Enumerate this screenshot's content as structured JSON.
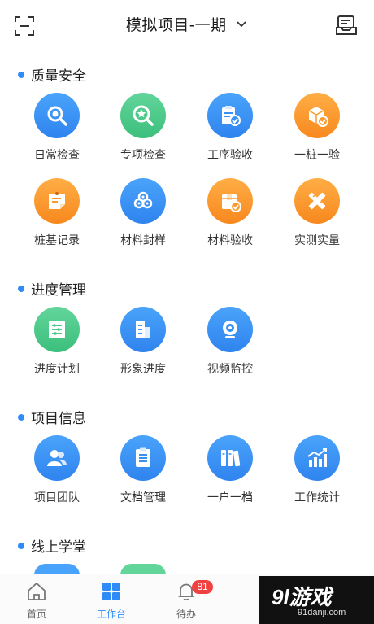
{
  "header": {
    "title": "模拟项目-一期",
    "scan_icon": "scan-icon",
    "message_icon": "message-icon"
  },
  "sections": [
    {
      "title": "质量安全",
      "items": [
        {
          "label": "日常检查",
          "color": "blue",
          "icon": "search-icon"
        },
        {
          "label": "专项检查",
          "color": "green",
          "icon": "star-search-icon"
        },
        {
          "label": "工序验收",
          "color": "blue",
          "icon": "clipboard-check-icon"
        },
        {
          "label": "一桩一验",
          "color": "orange",
          "icon": "box-check-icon"
        },
        {
          "label": "桩基记录",
          "color": "orange",
          "icon": "note-icon"
        },
        {
          "label": "材料封样",
          "color": "blue",
          "icon": "samples-icon"
        },
        {
          "label": "材料验收",
          "color": "orange",
          "icon": "package-check-icon"
        },
        {
          "label": "实测实量",
          "color": "orange",
          "icon": "ruler-pencil-icon"
        }
      ]
    },
    {
      "title": "进度管理",
      "items": [
        {
          "label": "进度计划",
          "color": "green",
          "icon": "plan-list-icon"
        },
        {
          "label": "形象进度",
          "color": "blue",
          "icon": "building-icon"
        },
        {
          "label": "视频监控",
          "color": "blue",
          "icon": "camera-icon"
        }
      ]
    },
    {
      "title": "项目信息",
      "items": [
        {
          "label": "项目团队",
          "color": "blue",
          "icon": "team-icon"
        },
        {
          "label": "文档管理",
          "color": "blue",
          "icon": "document-icon"
        },
        {
          "label": "一户一档",
          "color": "blue",
          "icon": "binders-icon"
        },
        {
          "label": "工作统计",
          "color": "blue",
          "icon": "chart-icon"
        }
      ]
    },
    {
      "title": "线上学堂",
      "items": []
    }
  ],
  "tabbar": {
    "tabs": [
      {
        "label": "首页",
        "icon": "home-icon",
        "active": false
      },
      {
        "label": "工作台",
        "icon": "grid-icon",
        "active": true
      },
      {
        "label": "待办",
        "icon": "bell-icon",
        "active": false,
        "badge": "81"
      }
    ]
  },
  "watermark": {
    "logo": "9l游戏",
    "sub": "91danji.com"
  },
  "colors": {
    "accent": "#2f8bf5",
    "blue": "#3a90f3",
    "green": "#4cc98a",
    "orange": "#f99b30",
    "badge": "#f04040"
  }
}
